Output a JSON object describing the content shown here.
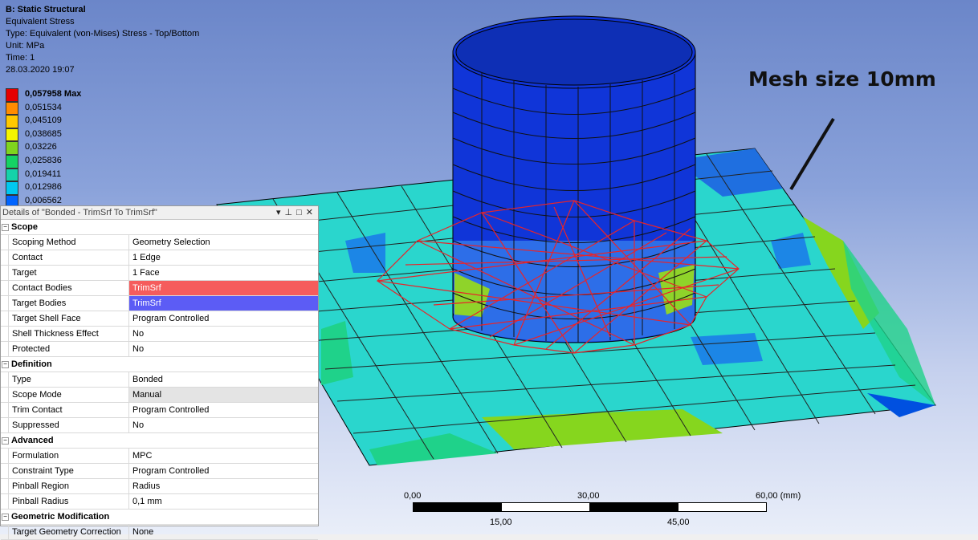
{
  "result": {
    "title": "B: Static Structural",
    "lines": [
      "Equivalent Stress",
      "Type: Equivalent (von-Mises) Stress - Top/Bottom",
      "Unit: MPa",
      "Time: 1",
      "28.03.2020 19:07"
    ]
  },
  "legend": {
    "entries": [
      {
        "label": "0,057958 Max",
        "color": "#e60000"
      },
      {
        "label": "0,051534",
        "color": "#ff8c00"
      },
      {
        "label": "0,045109",
        "color": "#ffc800"
      },
      {
        "label": "0,038685",
        "color": "#f5f500"
      },
      {
        "label": "0,03226",
        "color": "#7fd41e"
      },
      {
        "label": "0,025836",
        "color": "#14d264"
      },
      {
        "label": "0,019411",
        "color": "#14d2aa"
      },
      {
        "label": "0,012986",
        "color": "#00c8f0"
      },
      {
        "label": "0,006562",
        "color": "#0064ff"
      }
    ]
  },
  "annotation": "Mesh size 10mm",
  "scale": {
    "top": [
      "0,00",
      "30,00",
      "60,00 (mm)"
    ],
    "bottom": [
      "15,00",
      "45,00"
    ]
  },
  "details": {
    "title": "Details of \"Bonded - TrimSrf To TrimSrf\"",
    "controls": {
      "dropdown": "▾",
      "pin": "⊥",
      "maximize": "□",
      "close": "✕"
    },
    "groups": [
      {
        "name": "Scope",
        "rows": [
          {
            "name": "Scoping Method",
            "value": "Geometry Selection"
          },
          {
            "name": "Contact",
            "value": "1 Edge"
          },
          {
            "name": "Target",
            "value": "1 Face"
          },
          {
            "name": "Contact Bodies",
            "value": "TrimSrf",
            "highlight": "#f55c5c"
          },
          {
            "name": "Target Bodies",
            "value": "TrimSrf",
            "highlight": "#5c5cf5"
          },
          {
            "name": "Target Shell Face",
            "value": "Program Controlled"
          },
          {
            "name": "Shell Thickness Effect",
            "value": "No"
          },
          {
            "name": "Protected",
            "value": "No"
          }
        ]
      },
      {
        "name": "Definition",
        "rows": [
          {
            "name": "Type",
            "value": "Bonded"
          },
          {
            "name": "Scope Mode",
            "value": "Manual",
            "highlight": "#e4e4e4"
          },
          {
            "name": "Trim Contact",
            "value": "Program Controlled"
          },
          {
            "name": "Suppressed",
            "value": "No"
          }
        ]
      },
      {
        "name": "Advanced",
        "rows": [
          {
            "name": "Formulation",
            "value": "MPC"
          },
          {
            "name": "Constraint Type",
            "value": "Program Controlled"
          },
          {
            "name": "Pinball Region",
            "value": "Radius"
          },
          {
            "name": "Pinball Radius",
            "value": "0,1 mm"
          }
        ]
      },
      {
        "name": "Geometric Modification",
        "rows": [
          {
            "name": "Target Geometry Correction",
            "value": "None"
          }
        ]
      }
    ]
  }
}
